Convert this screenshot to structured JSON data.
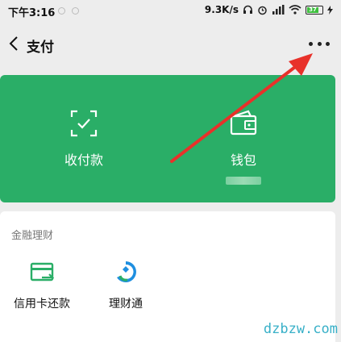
{
  "status_bar": {
    "time": "下午3:16",
    "network_speed": "9.3K/s",
    "battery": "37"
  },
  "navbar": {
    "title": "支付",
    "back_icon": "chevron-left-icon",
    "more_icon": "more-dots-icon"
  },
  "main": {
    "tiles": [
      {
        "label": "收付款",
        "icon": "scan-check-icon"
      },
      {
        "label": "钱包",
        "icon": "wallet-icon"
      }
    ]
  },
  "finance": {
    "title": "金融理财",
    "services": [
      {
        "label": "信用卡还款",
        "icon": "credit-card-icon"
      },
      {
        "label": "理财通",
        "icon": "wealth-icon"
      }
    ]
  },
  "watermark": "dzbzw.com",
  "colors": {
    "accent_green": "#2aae67",
    "arrow_red": "#e8312a",
    "background": "#ededed"
  }
}
